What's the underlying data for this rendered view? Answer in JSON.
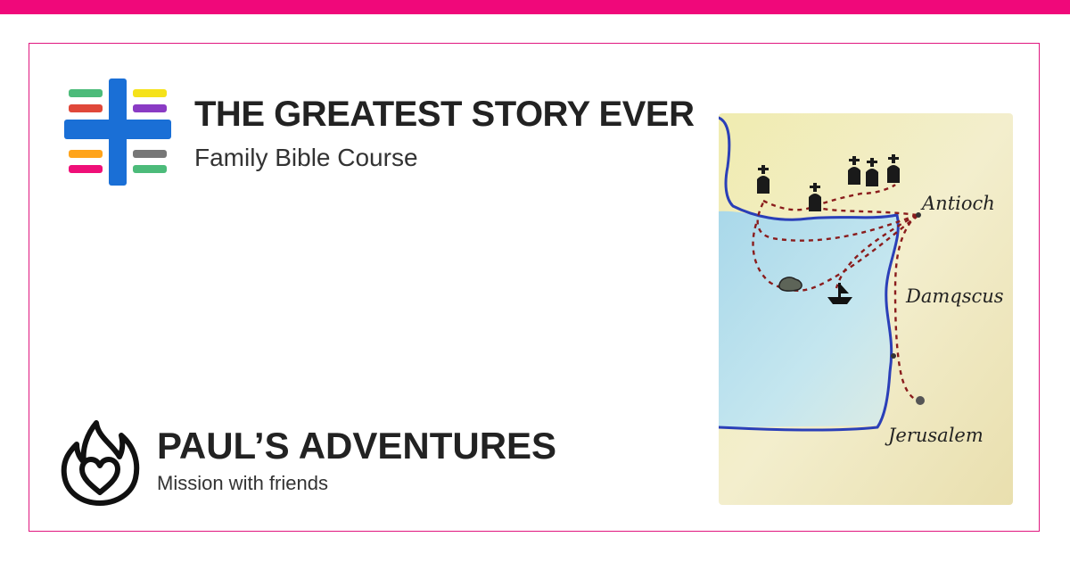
{
  "colors": {
    "accent": "#f0087a",
    "border": "#e0177f",
    "logo_blue": "#1a6fd6",
    "logo_green": "#4cbb7a",
    "logo_red": "#e0483a",
    "logo_yellow": "#f5e21a",
    "logo_purple": "#8a3bc4",
    "logo_orange": "#ffa41b",
    "logo_pink": "#ef0f78",
    "logo_gray": "#777777"
  },
  "brand": {
    "title": "THE GREATEST STORY EVER",
    "subtitle": "Family Bible Course",
    "logo_icon": "cross-lines-logo"
  },
  "lesson": {
    "title": "PAUL’S ADVENTURES",
    "subtitle": "Mission with friends",
    "icon": "flame-heart-icon"
  },
  "map": {
    "labels": {
      "antioch": "Antioch",
      "damascus": "Damqscus",
      "jerusalem": "Jerusalem"
    }
  }
}
